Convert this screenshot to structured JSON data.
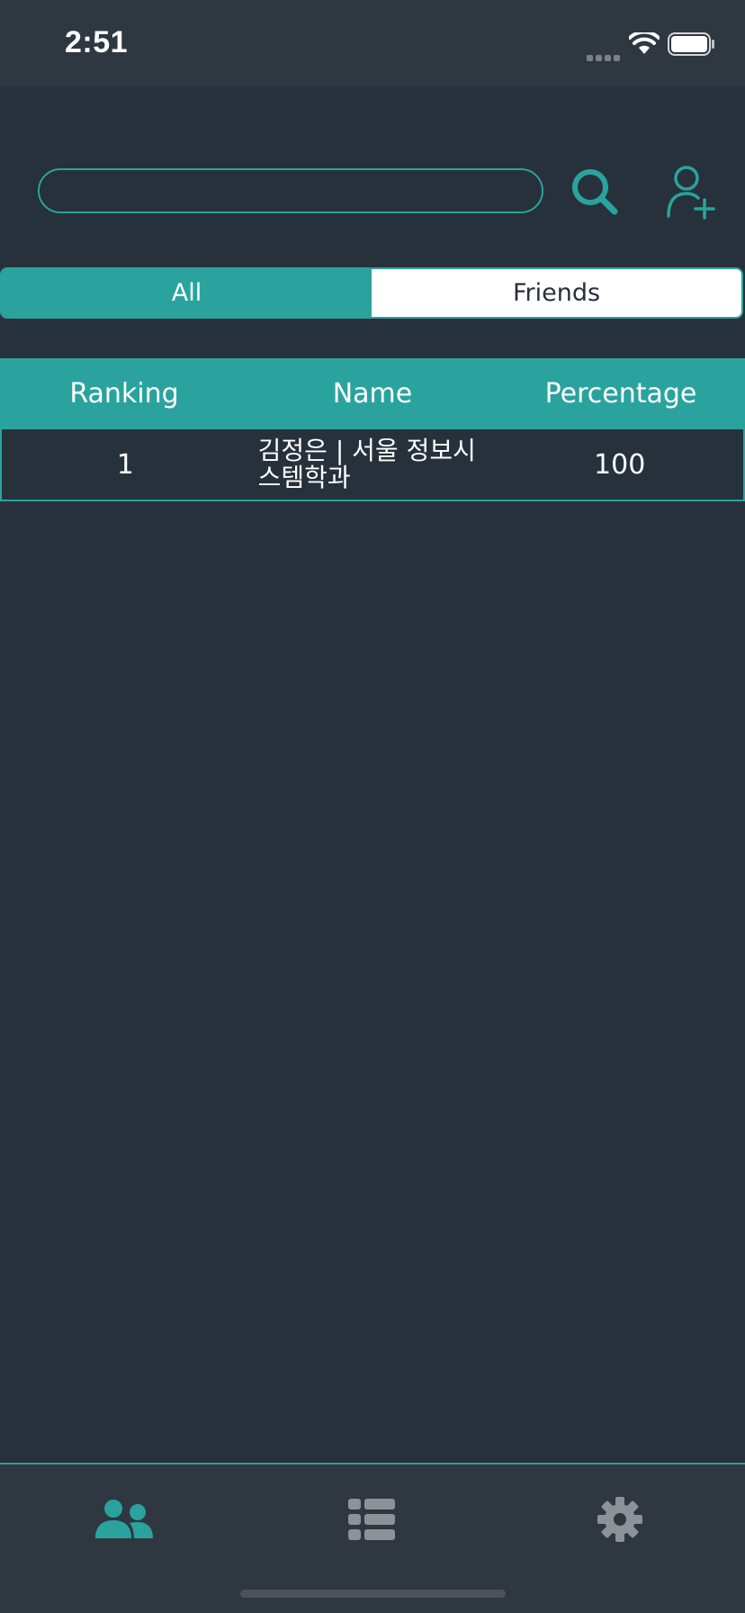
{
  "status_bar": {
    "time": "2:51"
  },
  "search": {
    "value": "",
    "placeholder": ""
  },
  "segments": {
    "items": [
      {
        "label": "All",
        "active": true
      },
      {
        "label": "Friends",
        "active": false
      }
    ]
  },
  "ranking_table": {
    "columns": [
      "Ranking",
      "Name",
      "Percentage"
    ],
    "rows": [
      {
        "ranking": "1",
        "name": "김정은 | 서울 정보시스템학과",
        "percentage": "100"
      }
    ]
  },
  "tab_bar": {
    "items": [
      {
        "icon": "users-icon",
        "active": true
      },
      {
        "icon": "list-icon",
        "active": false
      },
      {
        "icon": "gear-icon",
        "active": false
      }
    ]
  },
  "colors": {
    "accent": "#2aa39e",
    "background": "#27313b",
    "bar_background": "#2f3741",
    "inactive_icon": "#8e9298"
  }
}
